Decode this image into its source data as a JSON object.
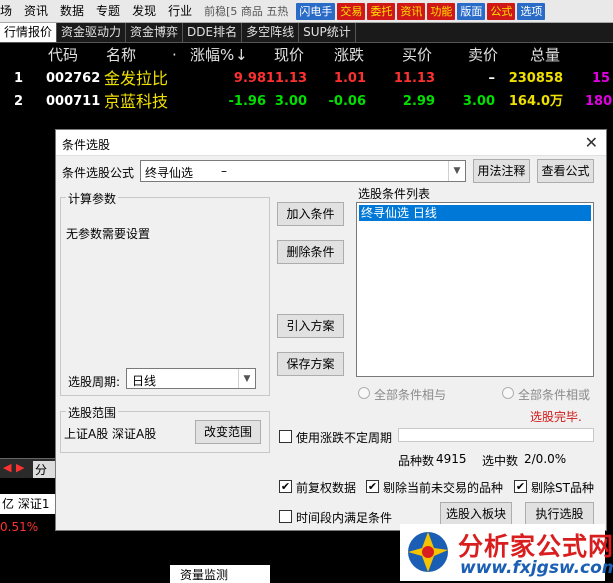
{
  "menubar": {
    "items": [
      "场",
      "资讯",
      "数据",
      "专题",
      "发现",
      "行业"
    ],
    "watermark": "前稳[5 商品 五热",
    "buttons": [
      {
        "label": "闪电手",
        "color": "#2b6bc8"
      },
      {
        "label": "交易",
        "color": "#d01818"
      },
      {
        "label": "委托",
        "color": "#d01818"
      },
      {
        "label": "资讯",
        "color": "#d01818"
      },
      {
        "label": "功能",
        "color": "#d01818"
      },
      {
        "label": "版面",
        "color": "#2b6bc8"
      },
      {
        "label": "公式",
        "color": "#d01818"
      },
      {
        "label": "选项",
        "color": "#2b6bc8"
      }
    ]
  },
  "tabs": [
    "行情报价",
    "资金驱动力",
    "资金博弈",
    "DDE排名",
    "多空阵线",
    "SUP统计"
  ],
  "table": {
    "headers": {
      "code": "代码",
      "name": "名称",
      "dot": "·",
      "change_pct": "涨幅%",
      "sort_icon": "↓",
      "price": "现价",
      "change": "涨跌",
      "bid": "买价",
      "ask": "卖价",
      "volume": "总量"
    },
    "rows": [
      {
        "index": "1",
        "code": "002762",
        "name": "金发拉比",
        "change_pct": "9.98",
        "price": "11.13",
        "change": "1.01",
        "bid": "11.13",
        "ask": "–",
        "volume": "230858",
        "extra": "15"
      },
      {
        "index": "2",
        "code": "000711",
        "name": "京蓝科技",
        "change_pct": "-1.96",
        "price": "3.00",
        "change": "-0.06",
        "bid": "2.99",
        "ask": "3.00",
        "volume": "164.0万",
        "extra": "180"
      }
    ]
  },
  "lower": {
    "arrow_left": "◀",
    "arrow_right": "▶",
    "tab": "分名",
    "header": "亿  深证1",
    "pct": "0.51%"
  },
  "bottom_bar": "资量监测",
  "dialog": {
    "title": "条件选股",
    "formula_label": "条件选股公式",
    "formula_value": "终寻仙选",
    "formula_dash": "–",
    "usage_button": "用法注释",
    "view_button": "查看公式",
    "calc_params_title": "计算参数",
    "no_params": "无参数需要设置",
    "period_label": "选股周期:",
    "period_value": "日线",
    "add_cond": "加入条件",
    "del_cond": "删除条件",
    "load_plan": "引入方案",
    "save_plan": "保存方案",
    "cond_list_title": "选股条件列表",
    "cond_item": "终寻仙选   日线",
    "radio_and": "全部条件相与",
    "radio_or": "全部条件相或",
    "status": "选股完毕.",
    "range_title": "选股范围",
    "range_text": "上证A股 深证A股",
    "change_range": "改变范围",
    "use_uncertain": "使用涨跌不定周期",
    "count_label": "品种数",
    "count_value": "4915",
    "selected_label": "选中数",
    "selected_value": "2/0.0%",
    "check_mark": "✔",
    "adjusted": "前复权数据",
    "exclude_untraded": "剔除当前未交易的品种",
    "exclude_st": "剔除ST品种",
    "time_range": "时间段内满足条件",
    "to_block": "选股入板块",
    "execute": "执行选股",
    "close_icon": "✕"
  },
  "logo": {
    "title": "分析家公式网",
    "url": "www.fxjgsw.com"
  }
}
